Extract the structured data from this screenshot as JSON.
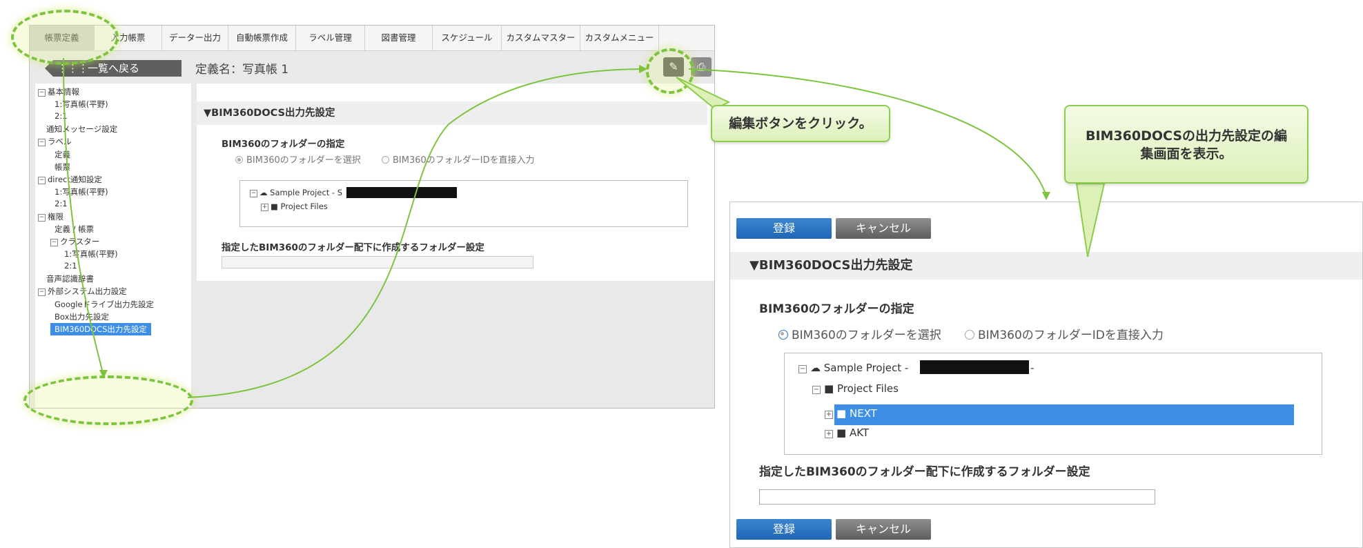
{
  "top_nav": {
    "tabs": [
      "帳票定義",
      "入力帳票",
      "データー出力",
      "自動帳票作成",
      "ラベル管理",
      "図書管理",
      "スケジュール",
      "カスタムマスター",
      "カスタムメニュー"
    ],
    "active_index": 0
  },
  "header": {
    "back_label": "一覧へ戻る",
    "back_icon": "grid-icon",
    "definition_name": "定義名：写真帳 1",
    "edit_icon": "edit-icon",
    "print_icon": "print-icon"
  },
  "tree": {
    "basic_info": "基本情報",
    "basic_1": "1:写真帳(平野)",
    "basic_2": "2:1",
    "notify_msg": "通知メッセージ設定",
    "label": "ラベル",
    "label_def": "定義",
    "label_form": "帳票",
    "direct": "direct通知設定",
    "direct_1": "1:写真帳(平野)",
    "direct_2": "2:1",
    "perm": "権限",
    "perm_def": "定義 / 帳票",
    "perm_cluster": "クラスター",
    "perm_c1": "1:写真帳(平野)",
    "perm_c2": "2:1",
    "voice": "音声認識辞書",
    "external": "外部システム出力設定",
    "gdrive": "Googleドライブ出力先設定",
    "box": "Box出力先設定",
    "bim360": "BIM360DOCS出力先設定"
  },
  "small_form": {
    "section_title": "▼BIM360DOCS出力先設定",
    "folder_label": "BIM360のフォルダーの指定",
    "radio_select": "BIM360のフォルダーを選択",
    "radio_id": "BIM360のフォルダーIDを直接入力",
    "project": "Sample Project - S",
    "project_files": "Project Files",
    "sub_label": "指定したBIM360のフォルダー配下に作成するフォルダー設定"
  },
  "callouts": {
    "edit_click": "編集ボタンをクリック。",
    "edit_screen": "BIM360DOCSの出力先設定の編集画面を表示。"
  },
  "panel": {
    "register": "登録",
    "cancel": "キャンセル",
    "section_title": "▼BIM360DOCS出力先設定",
    "folder_label": "BIM360のフォルダーの指定",
    "radio_select": "BIM360のフォルダーを選択",
    "radio_id": "BIM360のフォルダーIDを直接入力",
    "project": "Sample Project -",
    "project_suffix": "-",
    "project_files": "Project Files",
    "folder_next": "NEXT",
    "folder_akt": "AKT",
    "sub_label": "指定したBIM360のフォルダー配下に作成するフォルダー設定",
    "selected_radio": "select"
  },
  "colors": {
    "accent_green": "#7cc43d",
    "selected_blue": "#3d8ee6",
    "button_blue": "#2a74c2"
  }
}
